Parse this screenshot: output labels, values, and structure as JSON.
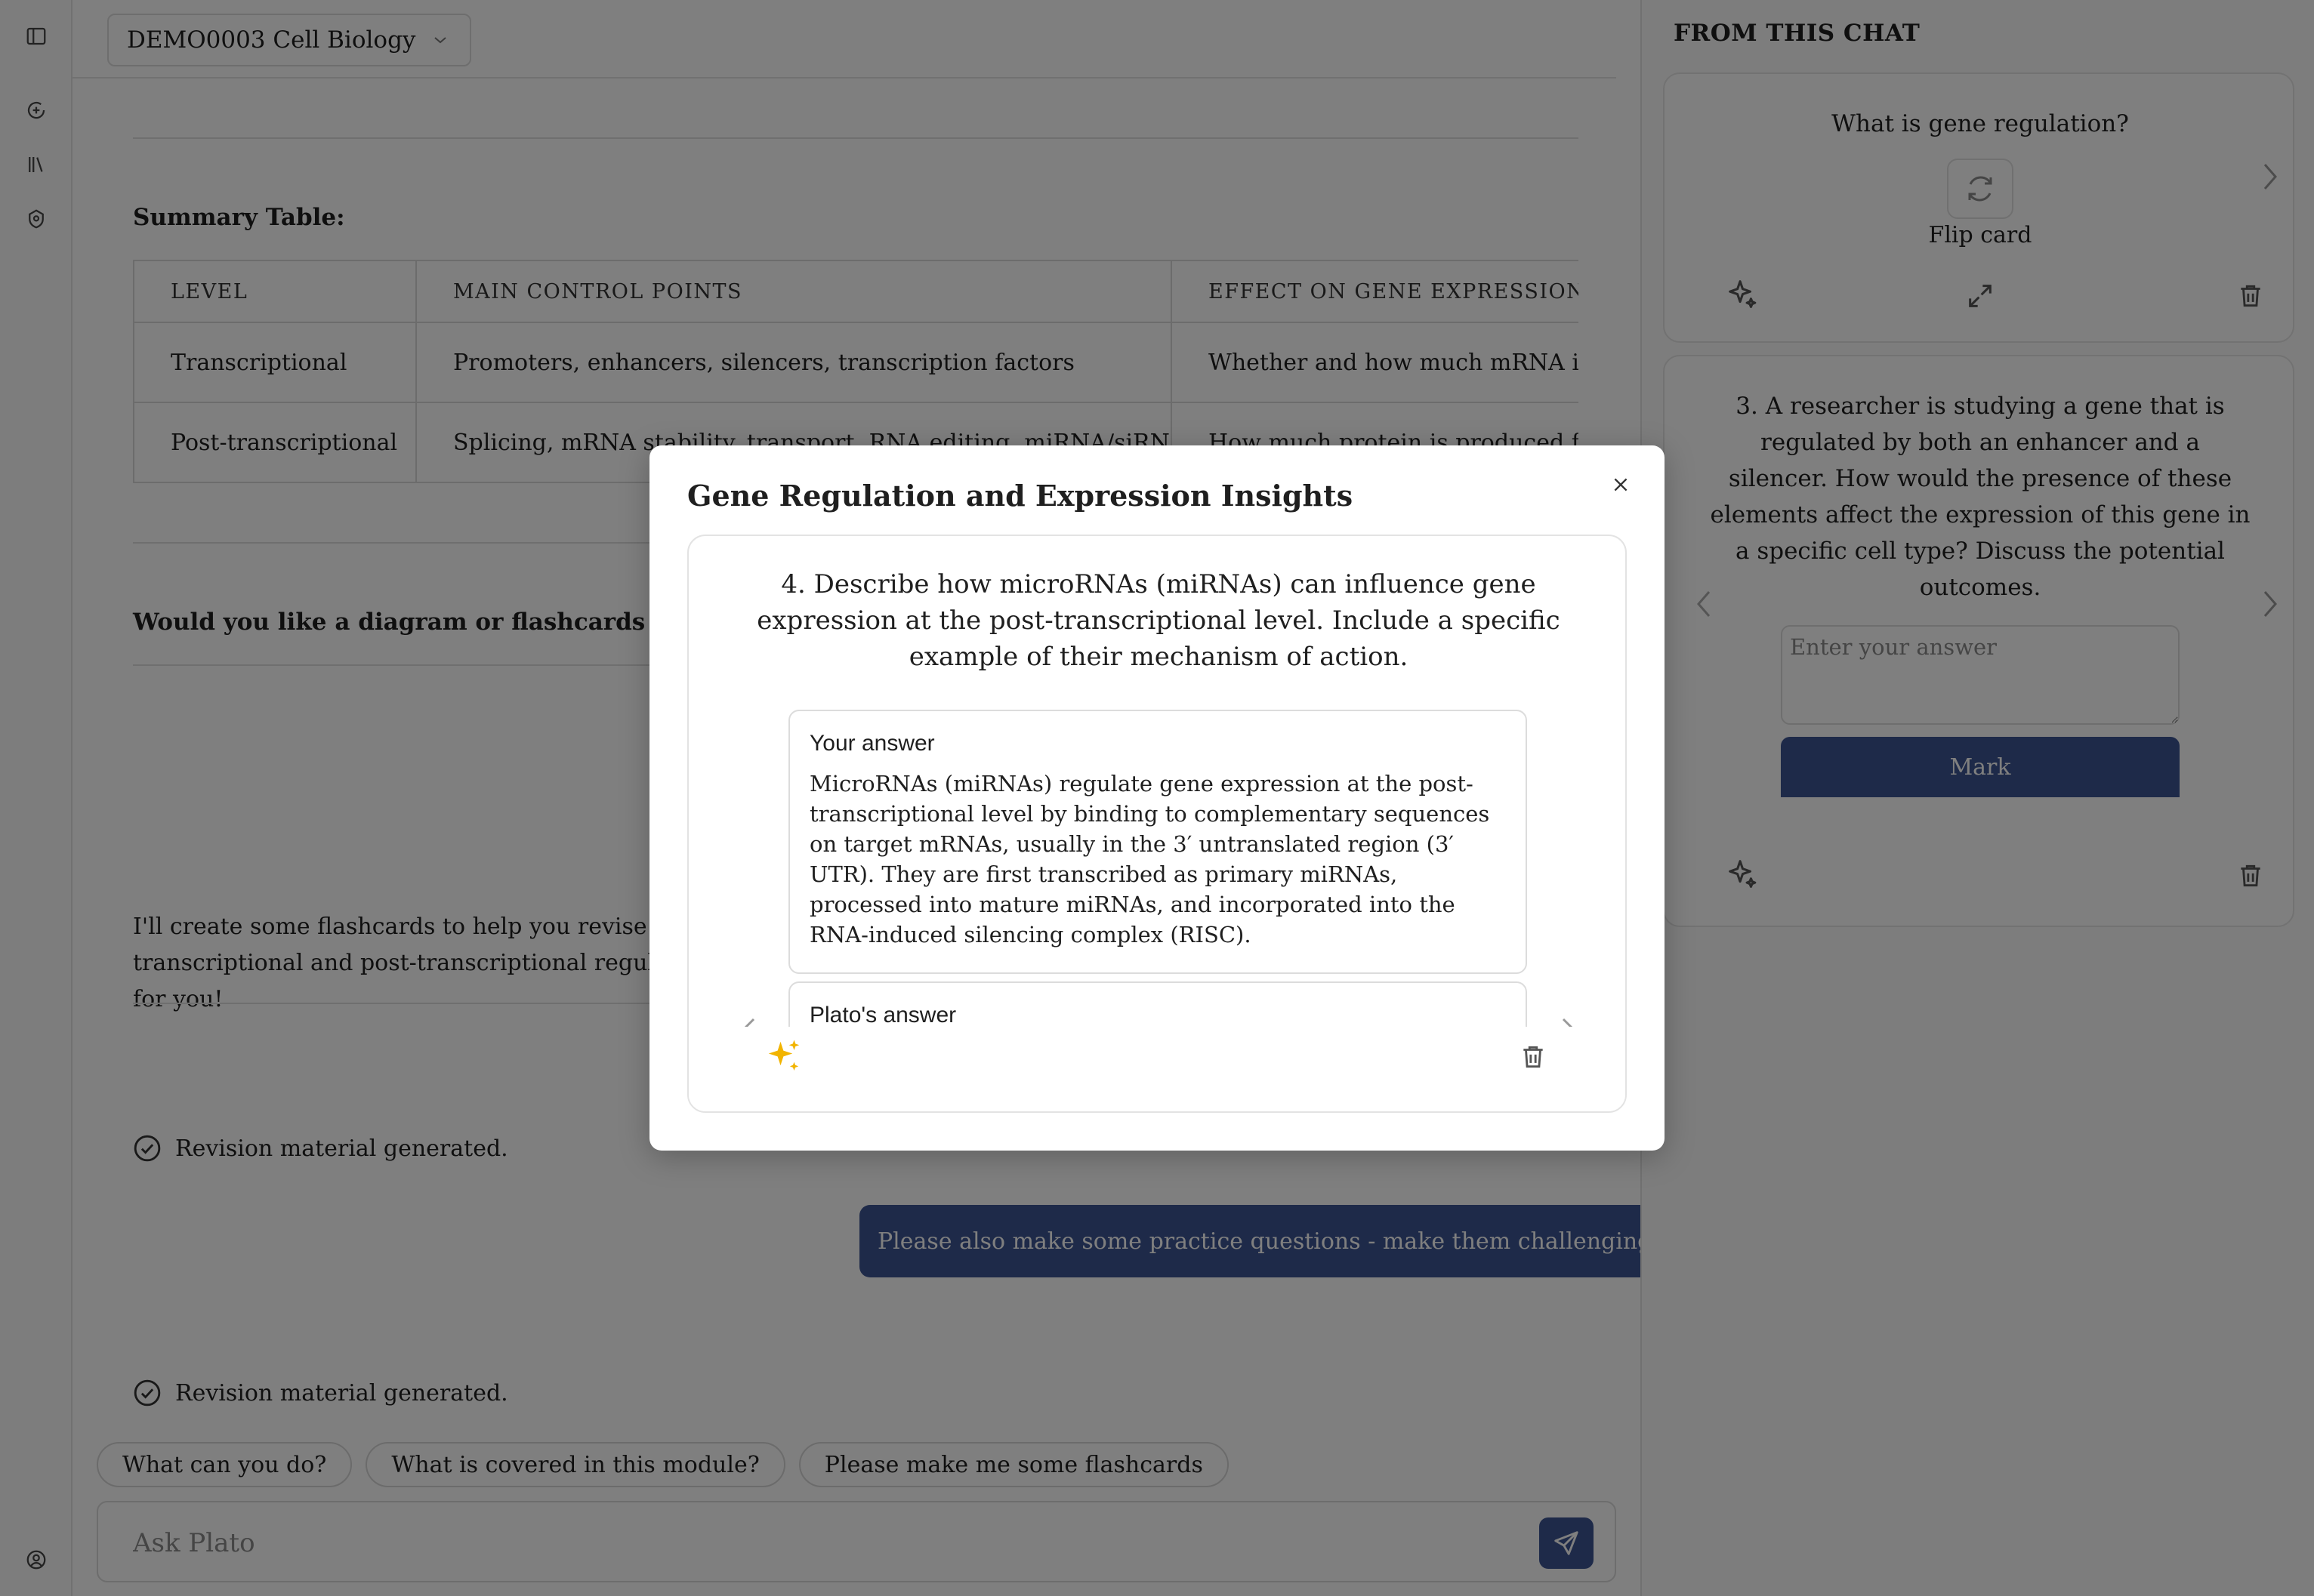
{
  "app": {
    "module_label": "DEMO0003 Cell Biology"
  },
  "summary": {
    "title": "Summary Table:",
    "columns": [
      "LEVEL",
      "MAIN CONTROL POINTS",
      "EFFECT ON GENE EXPRESSION"
    ],
    "rows": [
      [
        "Transcriptional",
        "Promoters, enhancers, silencers, transcription factors",
        "Whether and how much mRNA is made"
      ],
      [
        "Post-transcriptional",
        "Splicing, mRNA stability, transport, RNA editing, miRNA/siRNA",
        "How much protein is produced from mRNA"
      ]
    ]
  },
  "chat": {
    "question_line": "Would you like a diagram or flashcards to help you revise these?",
    "flashcard_message": "I'll create some flashcards to help you revise transcriptional and post-transcriptional regulation for you!",
    "status_1": "Revision material generated.",
    "user_message": "Please also make some practice questions - make them challenging!",
    "status_2": "Revision material generated."
  },
  "suggestions": [
    "What can you do?",
    "What is covered in this module?",
    "Please make me some flashcards"
  ],
  "composer": {
    "placeholder": "Ask Plato"
  },
  "right_panel": {
    "title": "FROM THIS CHAT",
    "flashcard": {
      "question": "What is gene regulation?",
      "flip_label": "Flip card"
    },
    "practice": {
      "question": "3. A researcher is studying a gene that is regulated by both an enhancer and a silencer. How would the presence of these elements affect the expression of this gene in a specific cell type? Discuss the potential outcomes.",
      "answer_placeholder": "Enter your answer",
      "mark_label": "Mark"
    }
  },
  "modal": {
    "title": "Gene Regulation and Expression Insights",
    "question": "4. Describe how microRNAs (miRNAs) can influence gene expression at the post-transcriptional level. Include a specific example of their mechanism of action.",
    "your_answer_label": "Your answer",
    "your_answer_text": "MicroRNAs (miRNAs) regulate gene expression at the post-transcriptional level by binding to complementary sequences on target mRNAs, usually in the 3′ untranslated region (3′ UTR). They are first transcribed as primary miRNAs, processed into mature miRNAs, and incorporated into the RNA-induced silencing complex (RISC).",
    "plato_answer_label": "Plato's answer"
  },
  "colors": {
    "accent": "#3c5492",
    "sparkle": "#f2b400",
    "overlay": "rgba(0,0,0,0.5)"
  },
  "icons": {
    "rail": [
      "sidebar-toggle-icon",
      "new-chat-icon",
      "library-icon",
      "shield-icon",
      "account-icon"
    ],
    "flashcard": [
      "chevron-right-icon",
      "refresh-icon",
      "sparkle-icon",
      "expand-icon",
      "trash-icon"
    ],
    "modal": [
      "close-icon",
      "sparkles-icon",
      "trash-icon",
      "chevron-left-icon",
      "chevron-right-icon"
    ]
  }
}
